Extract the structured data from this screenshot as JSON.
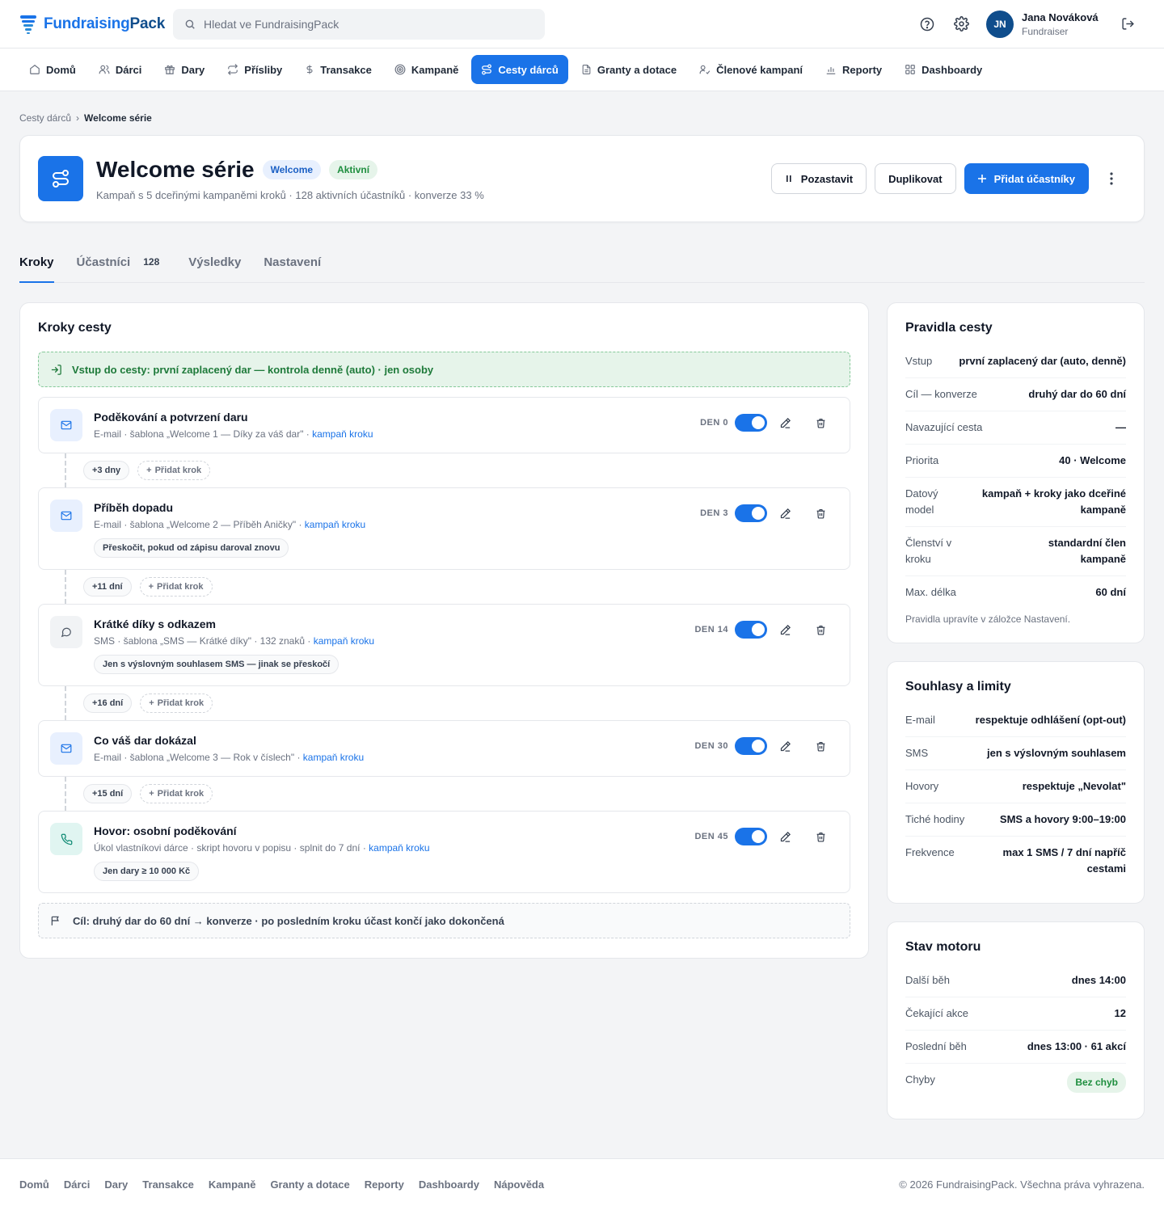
{
  "app": {
    "name_part1": "Fundraising",
    "name_part2": "Pack"
  },
  "search": {
    "placeholder": "Hledat ve FundraisingPack"
  },
  "user": {
    "initials": "JN",
    "name": "Jana Nováková",
    "role": "Fundraiser"
  },
  "nav": [
    {
      "label": "Domů",
      "icon": "home-icon"
    },
    {
      "label": "Dárci",
      "icon": "users-icon"
    },
    {
      "label": "Dary",
      "icon": "gift-icon"
    },
    {
      "label": "Přísliby",
      "icon": "repeat-icon"
    },
    {
      "label": "Transakce",
      "icon": "dollar-icon"
    },
    {
      "label": "Kampaně",
      "icon": "target-icon"
    },
    {
      "label": "Cesty dárců",
      "icon": "route-icon",
      "active": true
    },
    {
      "label": "Granty a dotace",
      "icon": "document-icon"
    },
    {
      "label": "Členové kampaní",
      "icon": "user-check-icon"
    },
    {
      "label": "Reporty",
      "icon": "bar-chart-icon"
    },
    {
      "label": "Dashboardy",
      "icon": "grid-icon"
    }
  ],
  "breadcrumb": {
    "parent": "Cesty dárců",
    "separator": "›",
    "current": "Welcome série"
  },
  "hero": {
    "title": "Welcome série",
    "badge_type": "Welcome",
    "badge_status": "Aktivní",
    "subtitle": "Kampaň s 5 dceřinými kampaněmi kroků · 128 aktivních účastníků · konverze 33 %",
    "pause_label": "Pozastavit",
    "duplicate_label": "Duplikovat",
    "add_label": "Přidat účastníky"
  },
  "tabs": [
    {
      "label": "Kroky",
      "active": true
    },
    {
      "label": "Účastníci",
      "count": "128"
    },
    {
      "label": "Výsledky"
    },
    {
      "label": "Nastavení"
    }
  ],
  "steps_card": {
    "title": "Kroky cesty",
    "entry": "Vstup do cesty: první zaplacený dar — kontrola denně (auto) · jen osoby",
    "goal": "Cíl: druhý dar do 60 dní → konverze · po posledním kroku účast končí jako dokončená",
    "add_step_label": "Přidat krok",
    "campaign_link": "kampaň kroku",
    "steps": [
      {
        "title": "Poděkování a potvrzení daru",
        "meta": "E-mail · šablona „Welcome 1 — Díky za váš dar\" · ",
        "day": "DEN 0",
        "icon": "mail-icon",
        "enabled": true
      },
      {
        "title": "Příběh dopadu",
        "meta": "E-mail · šablona „Welcome 2 — Příběh Aničky\" · ",
        "day": "DEN 3",
        "icon": "mail-icon",
        "enabled": true,
        "chip": "Přeskočit, pokud od zápisu daroval znovu"
      },
      {
        "title": "Krátké díky s odkazem",
        "meta": "SMS · šablona „SMS — Krátké díky\" · 132 znaků · ",
        "day": "DEN 14",
        "icon": "message-icon",
        "enabled": true,
        "chip": "Jen s výslovným souhlasem SMS — jinak se přeskočí"
      },
      {
        "title": "Co váš dar dokázal",
        "meta": "E-mail · šablona „Welcome 3 — Rok v číslech\" · ",
        "day": "DEN 30",
        "icon": "mail-icon",
        "enabled": true
      },
      {
        "title": "Hovor: osobní poděkování",
        "meta": "Úkol vlastníkovi dárce · skript hovoru v popisu · splnit do 7 dní · ",
        "day": "DEN 45",
        "icon": "phone-icon",
        "enabled": true,
        "chip": "Jen dary ≥ 10 000 Kč"
      }
    ],
    "delays": [
      "+3 dny",
      "+11 dní",
      "+16 dní",
      "+15 dní"
    ]
  },
  "rules": {
    "title": "Pravidla cesty",
    "rows": [
      {
        "k": "Vstup",
        "v": "první zaplacený dar (auto, denně)"
      },
      {
        "k": "Cíl — konverze",
        "v": "druhý dar do 60 dní"
      },
      {
        "k": "Navazující cesta",
        "v": "—"
      },
      {
        "k": "Priorita",
        "v": "40 · Welcome"
      },
      {
        "k": "Datový model",
        "v": "kampaň + kroky jako dceřiné kampaně"
      },
      {
        "k": "Členství v kroku",
        "v": "standardní člen kampaně"
      },
      {
        "k": "Max. délka",
        "v": "60 dní"
      }
    ],
    "note": "Pravidla upravíte v záložce Nastavení."
  },
  "consents": {
    "title": "Souhlasy a limity",
    "rows": [
      {
        "k": "E-mail",
        "v": "respektuje odhlášení (opt-out)"
      },
      {
        "k": "SMS",
        "v": "jen s výslovným souhlasem"
      },
      {
        "k": "Hovory",
        "v": "respektuje „Nevolat\""
      },
      {
        "k": "Tiché hodiny",
        "v": "SMS a hovory 9:00–19:00"
      },
      {
        "k": "Frekvence",
        "v": "max 1 SMS / 7 dní napříč cestami"
      }
    ]
  },
  "engine": {
    "title": "Stav motoru",
    "rows": [
      {
        "k": "Další běh",
        "v": "dnes 14:00"
      },
      {
        "k": "Čekající akce",
        "v": "12"
      },
      {
        "k": "Poslední běh",
        "v": "dnes 13:00 · 61 akcí"
      }
    ],
    "errors_label": "Chyby",
    "errors_value": "Bez chyb"
  },
  "footer": {
    "links": [
      "Domů",
      "Dárci",
      "Dary",
      "Transakce",
      "Kampaně",
      "Granty a dotace",
      "Reporty",
      "Dashboardy",
      "Nápověda"
    ],
    "copyright": "© 2026 FundraisingPack. Všechna práva vyhrazena."
  },
  "colors": {
    "accent": "#1a73e8",
    "success": "#1e8e3e",
    "brand_dark": "#0f4d8c"
  }
}
